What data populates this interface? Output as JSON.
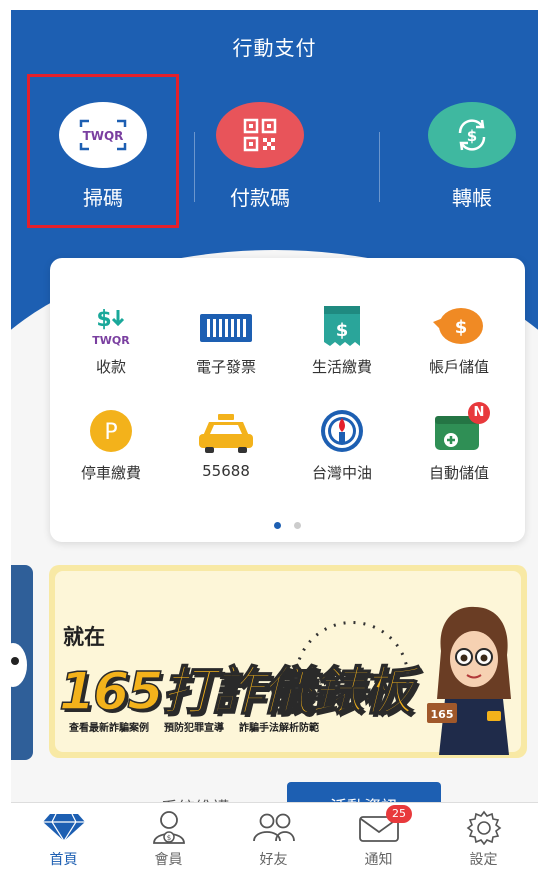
{
  "header": {
    "title": "行動支付",
    "buttons": [
      {
        "label": "掃碼",
        "icon": "twqr-scan-icon"
      },
      {
        "label": "付款碼",
        "icon": "qr-code-icon"
      },
      {
        "label": "轉帳",
        "icon": "transfer-icon"
      }
    ]
  },
  "services": {
    "items": [
      {
        "label": "收款",
        "icon": "receive-money-icon",
        "icon_text": "TWQR"
      },
      {
        "label": "電子發票",
        "icon": "barcode-icon"
      },
      {
        "label": "生活繳費",
        "icon": "bill-icon"
      },
      {
        "label": "帳戶儲值",
        "icon": "piggy-bank-icon"
      },
      {
        "label": "停車繳費",
        "icon": "parking-icon",
        "icon_text": "P"
      },
      {
        "label": "55688",
        "icon": "taxi-icon"
      },
      {
        "label": "台灣中油",
        "icon": "cpc-logo-icon"
      },
      {
        "label": "自動儲值",
        "icon": "wallet-icon",
        "badge": "N"
      }
    ],
    "page_count": 2,
    "active_page": 0
  },
  "banner": {
    "headline_small": "就在",
    "headline_big": "165打詐儀錶板",
    "tags": [
      "查看最新詐騙案例",
      "預防犯罪宣導",
      "詐騙手法解析防範"
    ],
    "sign_text": "165"
  },
  "partial_tabs": {
    "left": "系統維護",
    "right": "活動資訊"
  },
  "tabbar": {
    "items": [
      {
        "label": "首頁",
        "icon": "diamond-icon",
        "active": true
      },
      {
        "label": "會員",
        "icon": "member-icon"
      },
      {
        "label": "好友",
        "icon": "friends-icon"
      },
      {
        "label": "通知",
        "icon": "mail-icon",
        "badge": "25"
      },
      {
        "label": "設定",
        "icon": "gear-icon"
      }
    ]
  },
  "colors": {
    "primary_blue": "#1d5fb2",
    "scan_red_frame": "#e4202c",
    "qr_button": "#e8545a",
    "transfer_button": "#3fb8a0",
    "teal_icon": "#2aa59a",
    "orange_icon": "#f08a24",
    "yellow_icon": "#f3b21b",
    "green_icon": "#2f8f55",
    "badge_red": "#e8393c",
    "active_tab": "#1d5fb2"
  }
}
